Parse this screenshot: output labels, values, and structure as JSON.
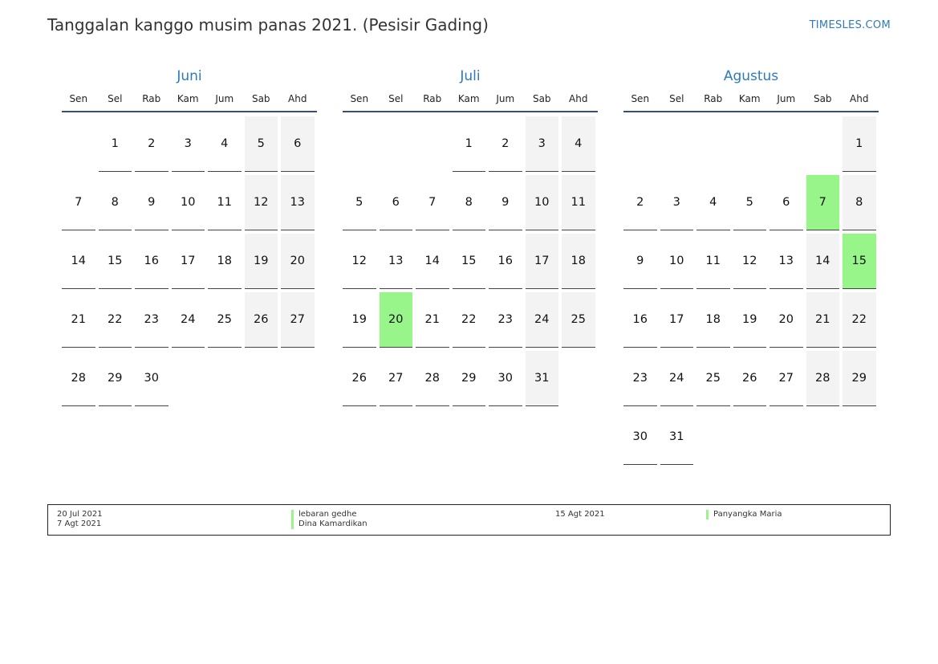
{
  "title": "Tanggalan kanggo musim panas 2021. (Pesisir Gading)",
  "brand": "TIMESLES.COM",
  "weekdays": [
    "Sen",
    "Sel",
    "Rab",
    "Kam",
    "Jum",
    "Sab",
    "Ahd"
  ],
  "colors": {
    "accent": "#2e7bb8",
    "holiday": "#98f58a",
    "weekend": "#f3f3f3",
    "rule": "#3a4f6e"
  },
  "months": [
    {
      "name": "Juni",
      "offset": 1,
      "days": 30,
      "holidays": []
    },
    {
      "name": "Juli",
      "offset": 3,
      "days": 31,
      "holidays": [
        20
      ]
    },
    {
      "name": "Agustus",
      "offset": 6,
      "days": 31,
      "holidays": [
        7,
        15
      ]
    }
  ],
  "legend": [
    {
      "date": "20 Jul 2021",
      "name": "lebaran gedhe"
    },
    {
      "date": "7 Agt 2021",
      "name": "Dina Kamardikan"
    },
    {
      "date": "15 Agt 2021",
      "name": "Panyangka Maria"
    }
  ]
}
